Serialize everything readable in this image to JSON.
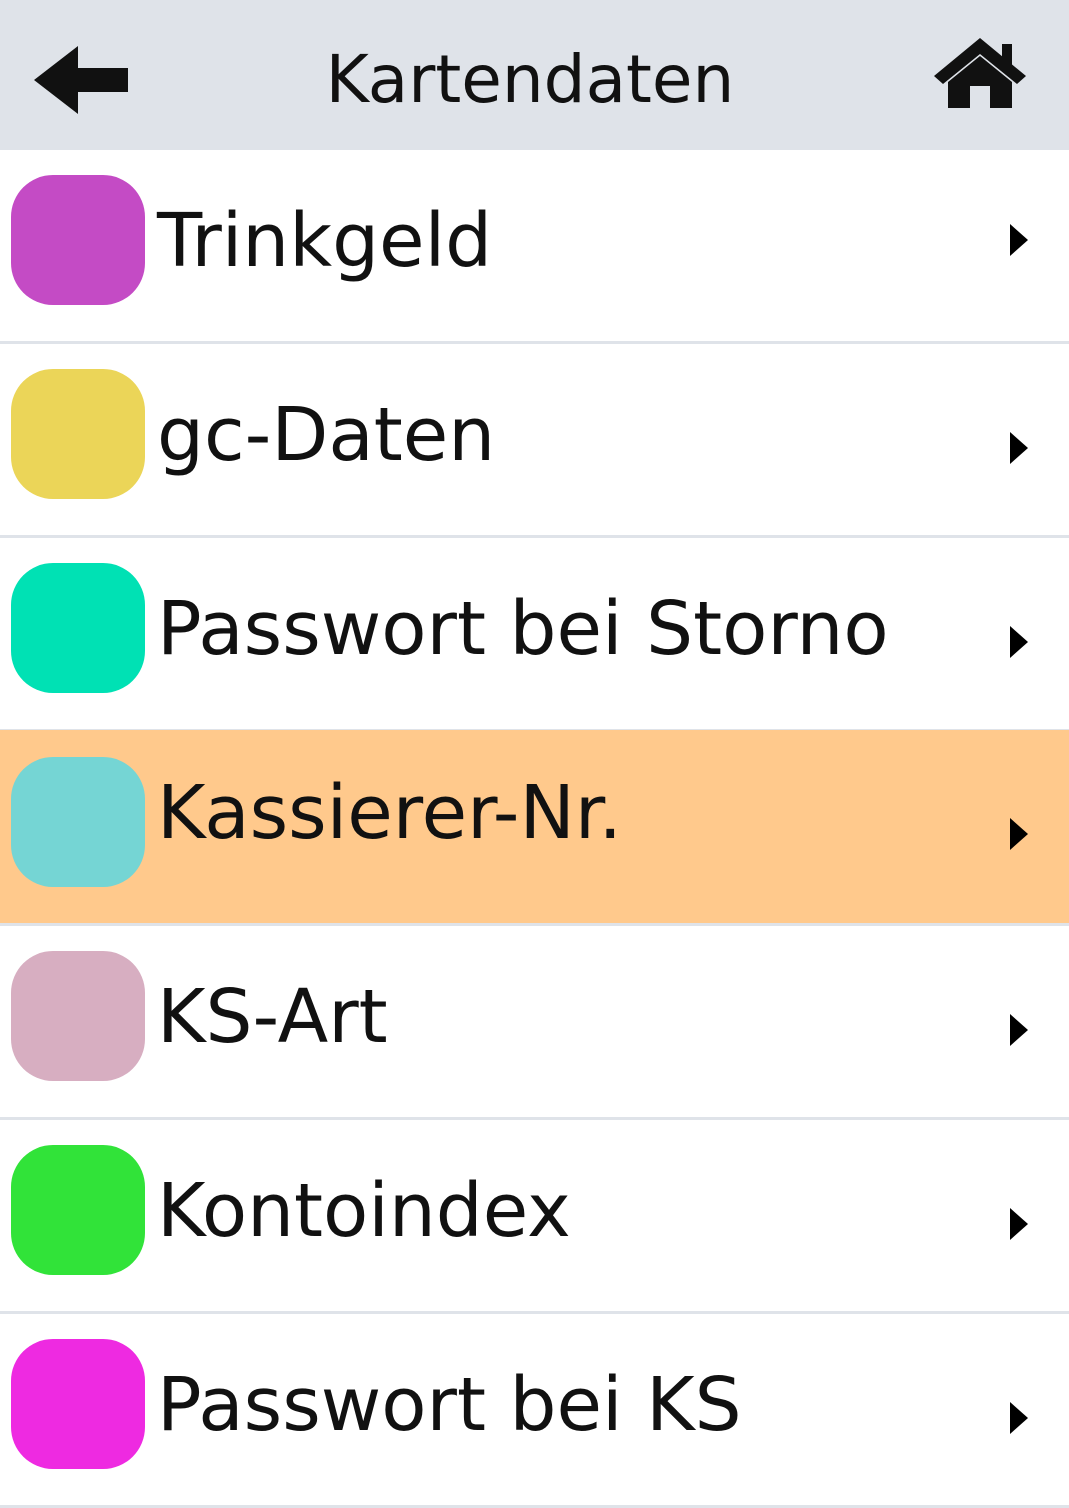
{
  "header": {
    "title": "Kartendaten",
    "back_icon": "back-arrow-icon",
    "home_icon": "home-icon",
    "background": "#dfe3e9"
  },
  "selected_index": 3,
  "items": [
    {
      "label": "Trinkgeld",
      "color": "#c44bc5"
    },
    {
      "label": "gc-Daten",
      "color": "#ebd558"
    },
    {
      "label": "Passwort bei Storno",
      "color": "#00e1b4"
    },
    {
      "label": "Kassierer-Nr.",
      "color": "#75d5d4"
    },
    {
      "label": "KS-Art",
      "color": "#d7aec1"
    },
    {
      "label": "Kontoindex",
      "color": "#31e339"
    },
    {
      "label": "Passwort bei KS",
      "color": "#ee2ae1"
    }
  ],
  "colors": {
    "selected_row": "#ffc98c",
    "separator": "#dfe3e9",
    "text": "#111111"
  }
}
